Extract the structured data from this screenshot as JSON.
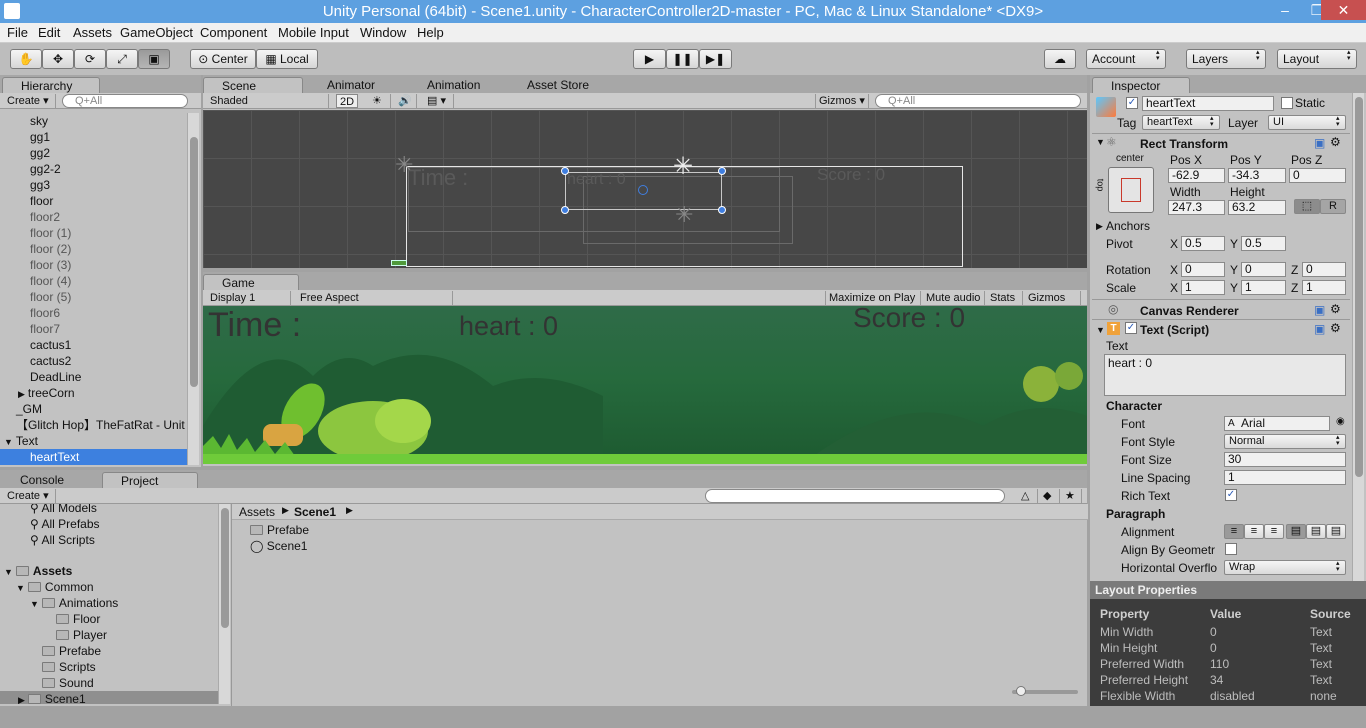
{
  "window": {
    "title": "Unity Personal (64bit) - Scene1.unity - CharacterController2D-master - PC, Mac & Linux Standalone* <DX9>"
  },
  "menu": [
    "File",
    "Edit",
    "Assets",
    "GameObject",
    "Component",
    "Mobile Input",
    "Window",
    "Help"
  ],
  "toolbar": {
    "center": "Center",
    "local": "Local",
    "account": "Account",
    "layers": "Layers",
    "layout": "Layout"
  },
  "hierarchy": {
    "tab": "Hierarchy",
    "create": "Create",
    "search_placeholder": "Q+All",
    "items": [
      "sky",
      "gg1",
      "gg2",
      "gg2-2",
      "gg3",
      "floor",
      "floor2",
      "floor (1)",
      "floor (2)",
      "floor (3)",
      "floor (4)",
      "floor (5)",
      "floor6",
      "floor7",
      "cactus1",
      "cactus2",
      "DeadLine",
      "treeCorn",
      "_GM",
      "【Glitch Hop】TheFatRat - Unit",
      "Text",
      "heartText"
    ]
  },
  "scene": {
    "tabs": [
      "Scene",
      "Animator",
      "Animation",
      "Asset Store"
    ],
    "shaded": "Shaded",
    "mode2d": "2D",
    "gizmos": "Gizmos",
    "search_placeholder": "Q+All",
    "texts": {
      "time": "Time :",
      "heart": "heart : 0",
      "score": "Score : 0"
    }
  },
  "game": {
    "tab": "Game",
    "display": "Display 1",
    "aspect": "Free Aspect",
    "buttons": [
      "Maximize on Play",
      "Mute audio",
      "Stats",
      "Gizmos"
    ],
    "texts": {
      "time": "Time :",
      "heart": "heart : 0",
      "score": "Score : 0"
    }
  },
  "bottom": {
    "tabs": [
      "Console",
      "Project"
    ],
    "create": "Create",
    "favorites": [
      "All Models",
      "All Prefabs",
      "All Scripts"
    ],
    "tree": {
      "assets": "Assets",
      "common": "Common",
      "animations": "Animations",
      "floor": "Floor",
      "player": "Player",
      "prefabe": "Prefabe",
      "scripts": "Scripts",
      "sound": "Sound",
      "scene1": "Scene1"
    },
    "breadcrumb": [
      "Assets",
      "Scene1"
    ],
    "files": [
      "Prefabe",
      "Scene1"
    ]
  },
  "inspector": {
    "tab": "Inspector",
    "object_name": "heartText",
    "static_label": "Static",
    "tag_label": "Tag",
    "tag_value": "heartText",
    "layer_label": "Layer",
    "layer_value": "UI",
    "rect_transform": {
      "title": "Rect Transform",
      "anchor_preset": "center",
      "side_label": "top",
      "labels": {
        "pos_x": "Pos X",
        "pos_y": "Pos Y",
        "pos_z": "Pos Z",
        "width": "Width",
        "height": "Height",
        "anchors": "Anchors",
        "pivot": "Pivot",
        "rotation": "Rotation",
        "scale": "Scale"
      },
      "pos_x": "-62.9",
      "pos_y": "-34.3",
      "pos_z": "0",
      "width": "247.3",
      "height": "63.2",
      "r_button": "R",
      "pivot": {
        "x": "0.5",
        "y": "0.5"
      },
      "rotation": {
        "x": "0",
        "y": "0",
        "z": "0"
      },
      "scale": {
        "x": "1",
        "y": "1",
        "z": "1"
      }
    },
    "canvas_renderer": "Canvas Renderer",
    "text_script": {
      "title": "Text (Script)",
      "text_label": "Text",
      "text_value": "heart : 0",
      "character": "Character",
      "font_label": "Font",
      "font_value": "Arial",
      "font_style_label": "Font Style",
      "font_style_value": "Normal",
      "font_size_label": "Font Size",
      "font_size_value": "30",
      "line_spacing_label": "Line Spacing",
      "line_spacing_value": "1",
      "rich_text_label": "Rich Text",
      "paragraph": "Paragraph",
      "alignment_label": "Alignment",
      "align_geometry_label": "Align By Geometr",
      "horizontal_overflow_label": "Horizontal Overflo",
      "horizontal_overflow_value": "Wrap"
    },
    "layout_properties": {
      "title": "Layout Properties",
      "headers": [
        "Property",
        "Value",
        "Source"
      ],
      "rows": [
        [
          "Min Width",
          "0",
          "Text"
        ],
        [
          "Min Height",
          "0",
          "Text"
        ],
        [
          "Preferred Width",
          "110",
          "Text"
        ],
        [
          "Preferred Height",
          "34",
          "Text"
        ],
        [
          "Flexible Width",
          "disabled",
          "none"
        ]
      ]
    }
  }
}
